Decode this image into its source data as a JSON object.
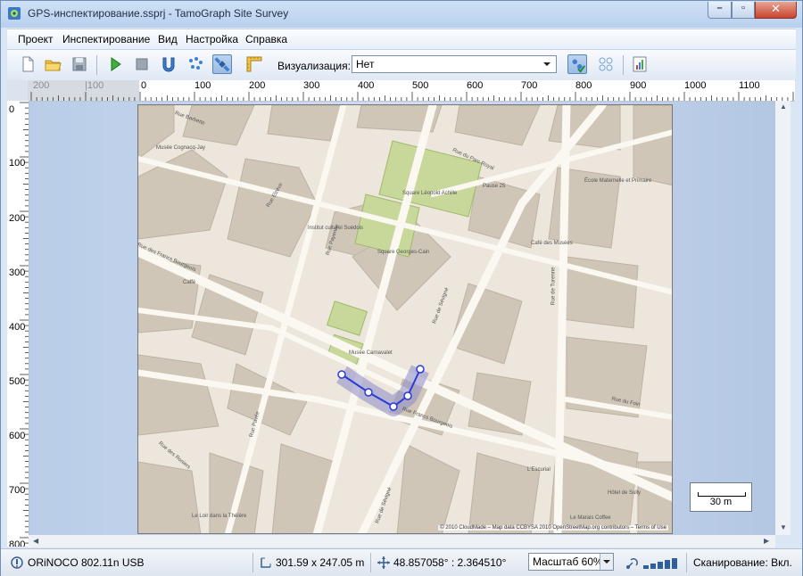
{
  "window": {
    "title": "GPS-инспектирование.ssprj - TamoGraph Site Survey",
    "icon": "tamograph-app-icon"
  },
  "menu": {
    "items": [
      {
        "label": "Проект"
      },
      {
        "label": "Инспектирование"
      },
      {
        "label": "Вид"
      },
      {
        "label": "Настройка"
      },
      {
        "label": "Справка"
      }
    ]
  },
  "toolbar": {
    "buttons": [
      {
        "name": "new-project",
        "icon": "new-document-icon"
      },
      {
        "name": "open-project",
        "icon": "open-folder-icon"
      },
      {
        "name": "save-project",
        "icon": "save-disk-icon"
      },
      {
        "name": "start-survey",
        "icon": "play-icon"
      },
      {
        "name": "stop-survey",
        "icon": "stop-icon"
      },
      {
        "name": "passive-survey",
        "icon": "magnet-icon"
      },
      {
        "name": "active-survey",
        "icon": "dots-icon"
      },
      {
        "name": "gps-mode",
        "icon": "satellite-icon"
      },
      {
        "name": "calibrate",
        "icon": "ruler-icon"
      }
    ],
    "visualization_label": "Визуализация:",
    "visualization_value": "Нет"
  },
  "ruler": {
    "top_labels": [
      "200",
      "100",
      "0",
      "100",
      "200",
      "300",
      "400",
      "500",
      "600",
      "700",
      "800",
      "900",
      "1000",
      "1100"
    ],
    "left_labels": [
      "0",
      "100",
      "200",
      "300",
      "400",
      "500",
      "600",
      "700",
      "800"
    ]
  },
  "map": {
    "attribution": "© 2010 CloudMade – Map data CCBYSA 2010 OpenStreetMap.org contributors – Terms of Use",
    "scale_label": "30 m",
    "streets": [
      "Rue Barbette",
      "Rue Elzévir",
      "Rue Payenne",
      "Rue de Sévigné",
      "Rue du Parc Royal",
      "Rue de Turenne",
      "Rue du Foin",
      "Rue des Rosiers",
      "Rue Pavée",
      "Rue des Francs Bourgeois",
      "Rue de Sévigné",
      "Rue Francs Bourgeois"
    ],
    "places": [
      "Musée Cognacq-Jay",
      "Square Léopold Achille",
      "Square Georges-Cain",
      "Musée Carnavalet",
      "Institut culturel Suédois",
      "Pause 25",
      "Café des Musées",
      "École Maternelle et Primaire",
      "Caffè",
      "L'Escurial",
      "Hôtel de Sully",
      "Le Loir dans la Théière",
      "Le Marais Coffee"
    ]
  },
  "status": {
    "adapter": "ORiNOCO 802.11n USB",
    "dimensions": "301.59 x 247.05 m",
    "coordinates": "48.857058° : 2.364510°",
    "zoom": "Масштаб 60%",
    "signal_bars": 5,
    "scanning": "Сканирование: Вкл."
  }
}
